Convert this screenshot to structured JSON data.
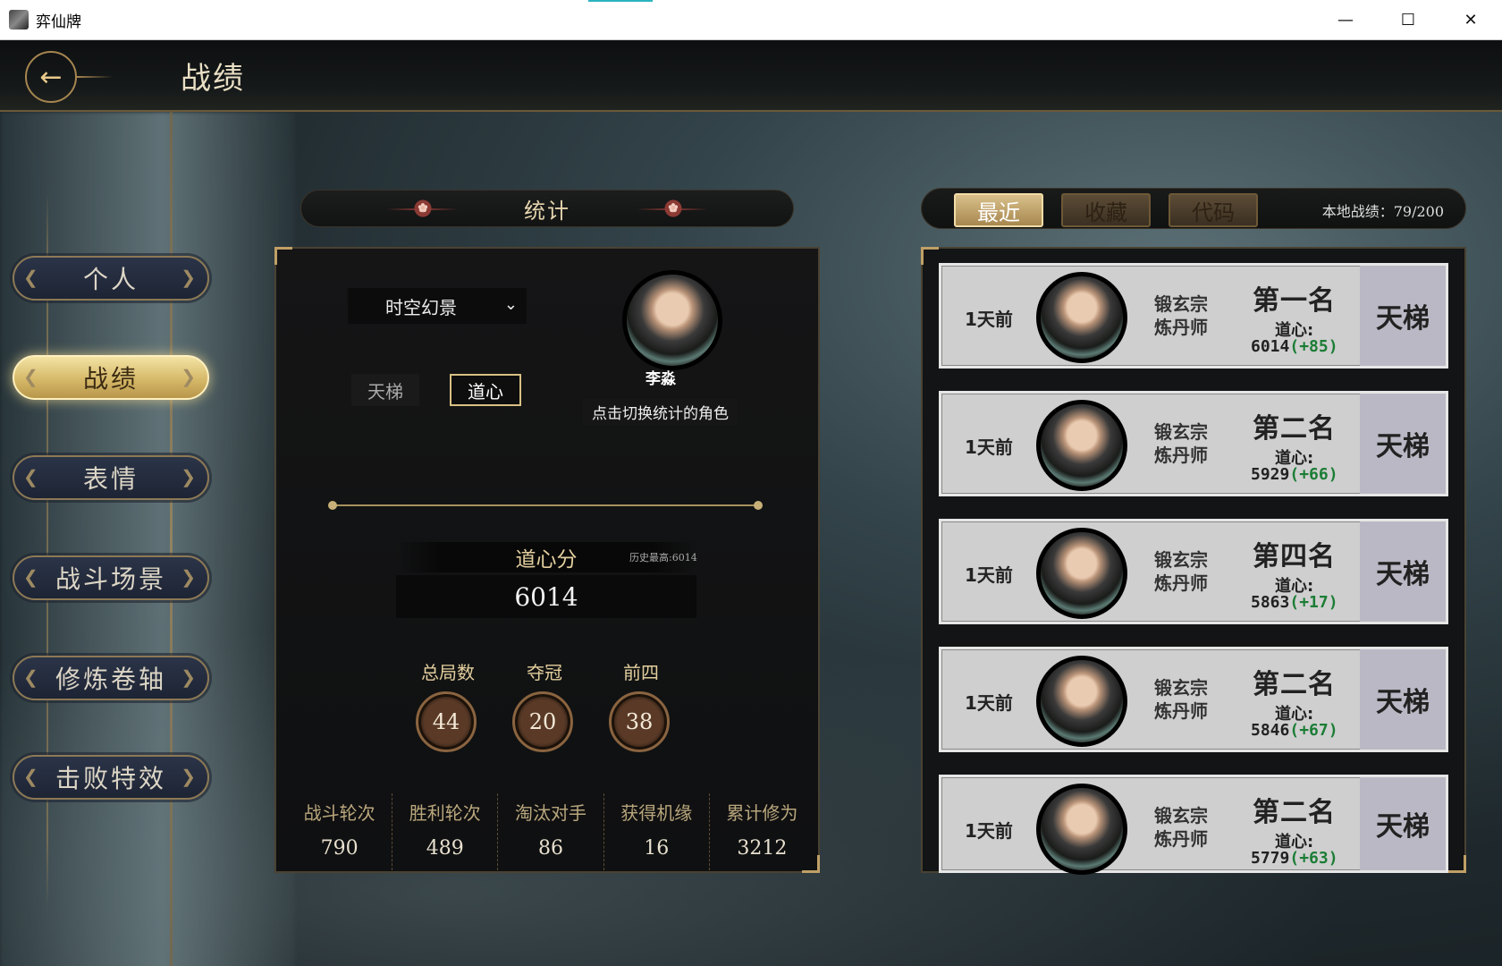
{
  "window": {
    "title": "弈仙牌",
    "minimize": "—",
    "maximize": "☐",
    "close": "✕"
  },
  "header": {
    "back_icon": "←",
    "title": "战绩"
  },
  "sidebar": {
    "items": [
      {
        "label": "个人",
        "active": false
      },
      {
        "label": "战绩",
        "active": true
      },
      {
        "label": "表情",
        "active": false
      },
      {
        "label": "战斗场景",
        "active": false
      },
      {
        "label": "修炼卷轴",
        "active": false
      },
      {
        "label": "击败特效",
        "active": false
      }
    ]
  },
  "stats": {
    "header": "统计",
    "mode_select": {
      "value": "时空幻景",
      "chevron": "⌄"
    },
    "toggles": {
      "ladder": "天梯",
      "daoxin": "道心",
      "selected": "道心"
    },
    "role": {
      "name": "李淼",
      "hint": "点击切换统计的角色"
    },
    "score": {
      "label": "道心分",
      "best": "历史最高:6014",
      "value": "6014"
    },
    "badges": [
      {
        "label": "总局数",
        "value": "44"
      },
      {
        "label": "夺冠",
        "value": "20"
      },
      {
        "label": "前四",
        "value": "38"
      }
    ],
    "bottom": [
      {
        "label": "战斗轮次",
        "value": "790"
      },
      {
        "label": "胜利轮次",
        "value": "489"
      },
      {
        "label": "淘汰对手",
        "value": "86"
      },
      {
        "label": "获得机缘",
        "value": "16"
      },
      {
        "label": "累计修为",
        "value": "3212"
      }
    ]
  },
  "records": {
    "tabs": [
      {
        "label": "最近",
        "active": true
      },
      {
        "label": "收藏",
        "active": false
      },
      {
        "label": "代码",
        "active": false
      }
    ],
    "local_count": "本地战绩：79/200",
    "items": [
      {
        "time": "1天前",
        "sect": "锻玄宗",
        "role": "炼丹师",
        "rank": "第一名",
        "daoxin_label": "道心:",
        "score": "6014",
        "delta": "(+85)",
        "mode": "天梯"
      },
      {
        "time": "1天前",
        "sect": "锻玄宗",
        "role": "炼丹师",
        "rank": "第二名",
        "daoxin_label": "道心:",
        "score": "5929",
        "delta": "(+66)",
        "mode": "天梯"
      },
      {
        "time": "1天前",
        "sect": "锻玄宗",
        "role": "炼丹师",
        "rank": "第四名",
        "daoxin_label": "道心:",
        "score": "5863",
        "delta": "(+17)",
        "mode": "天梯"
      },
      {
        "time": "1天前",
        "sect": "锻玄宗",
        "role": "炼丹师",
        "rank": "第二名",
        "daoxin_label": "道心:",
        "score": "5846",
        "delta": "(+67)",
        "mode": "天梯"
      },
      {
        "time": "1天前",
        "sect": "锻玄宗",
        "role": "炼丹师",
        "rank": "第二名",
        "daoxin_label": "道心:",
        "score": "5779",
        "delta": "(+63)",
        "mode": "天梯"
      }
    ]
  }
}
